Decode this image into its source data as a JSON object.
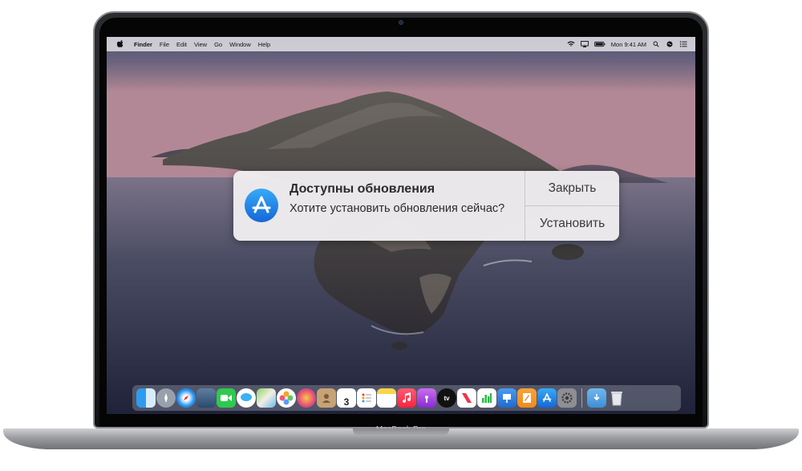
{
  "device_label": "MacBook Pro",
  "menubar": {
    "apple": "",
    "items": [
      "Finder",
      "File",
      "Edit",
      "View",
      "Go",
      "Window",
      "Help"
    ],
    "clock": "Mon 9:41 AM"
  },
  "notification": {
    "title": "Доступны обновления",
    "body": "Хотите установить обновления сейчас?",
    "close_label": "Закрыть",
    "install_label": "Установить",
    "icon": "app-store-icon"
  },
  "dock": {
    "calendar_day": "3",
    "tv_label": "tv",
    "icons": [
      "finder",
      "launchpad",
      "safari",
      "photo-booth",
      "facetime",
      "messages",
      "maps",
      "photos",
      "photos-app",
      "contacts",
      "calendar",
      "reminders",
      "notes",
      "music",
      "podcasts",
      "tv",
      "news",
      "numbers",
      "keynote",
      "pages",
      "app-store",
      "system-preferences",
      "downloads-folder",
      "trash"
    ]
  }
}
